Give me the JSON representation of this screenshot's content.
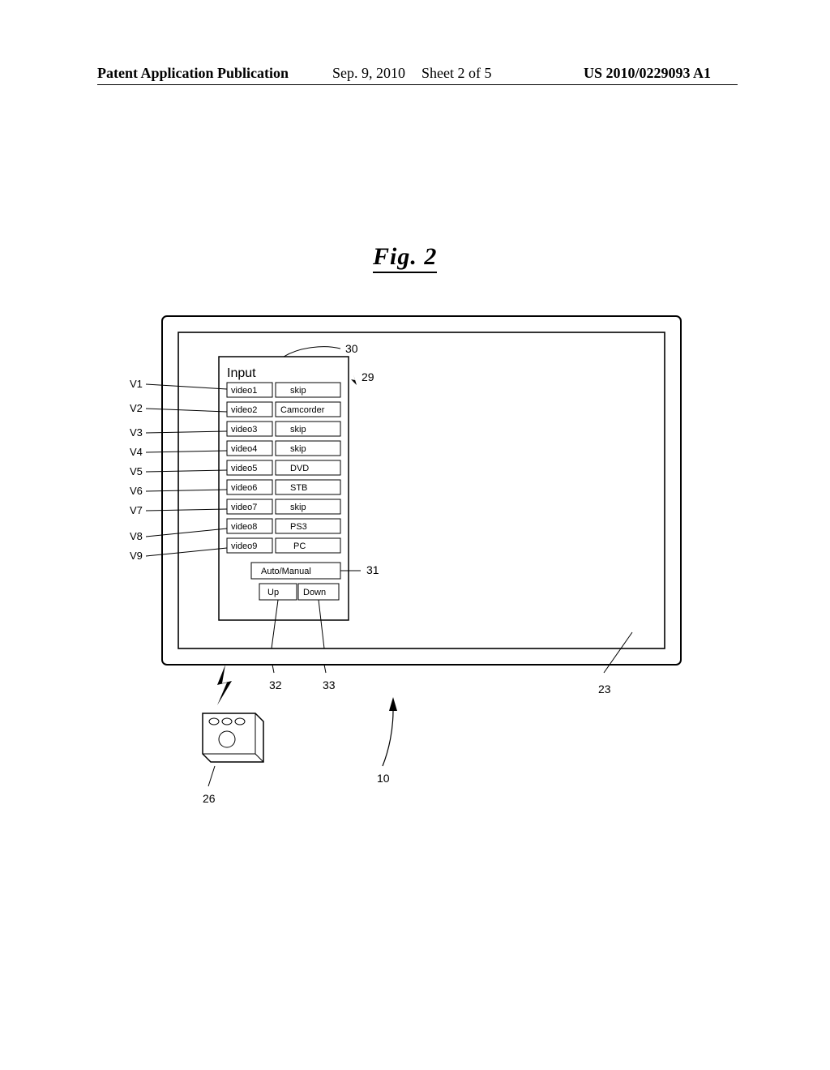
{
  "header": {
    "publication_label": "Patent Application Publication",
    "date": "Sep. 9, 2010",
    "sheet": "Sheet 2 of 5",
    "publication_number": "US 2010/0229093 A1"
  },
  "figure": {
    "title": "Fig. 2",
    "menu_header": "Input",
    "rows": [
      {
        "label": "V1",
        "name": "video1",
        "value": "skip"
      },
      {
        "label": "V2",
        "name": "video2",
        "value": "Camcorder"
      },
      {
        "label": "V3",
        "name": "video3",
        "value": "skip"
      },
      {
        "label": "V4",
        "name": "video4",
        "value": "skip"
      },
      {
        "label": "V5",
        "name": "video5",
        "value": "DVD"
      },
      {
        "label": "V6",
        "name": "video6",
        "value": "STB"
      },
      {
        "label": "V7",
        "name": "video7",
        "value": "skip"
      },
      {
        "label": "V8",
        "name": "video8",
        "value": "PS3"
      },
      {
        "label": "V9",
        "name": "video9",
        "value": "PC"
      }
    ],
    "auto_manual": "Auto/Manual",
    "up": "Up",
    "down": "Down",
    "callouts": {
      "menu_panel": "30",
      "arrowhead_near_menu": "29",
      "display": "23",
      "system": "10",
      "remote": "26",
      "auto_manual_ref": "31",
      "up_ref": "32",
      "down_ref": "33"
    }
  }
}
